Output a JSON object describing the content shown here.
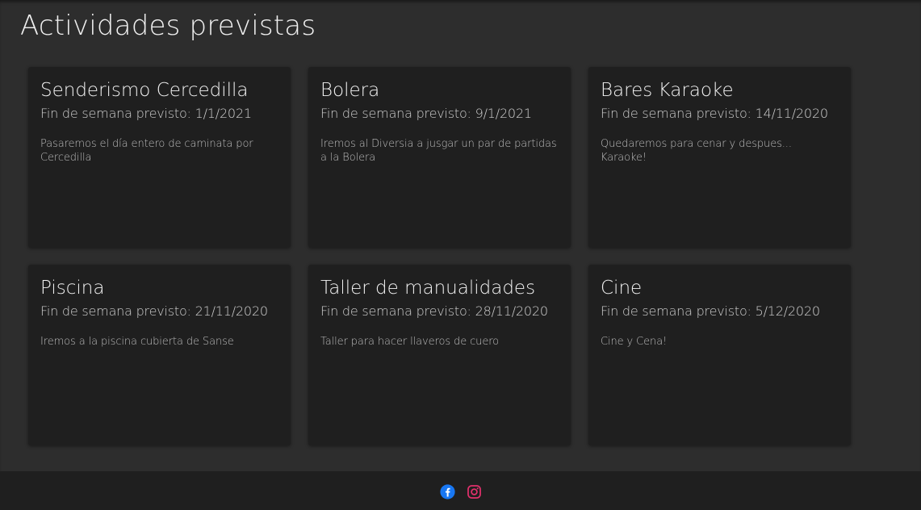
{
  "page": {
    "title": "Actividades previstas"
  },
  "activities": [
    {
      "title": "Senderismo Cercedilla",
      "date": "Fin de semana previsto: 1/1/2021",
      "description": "Pasaremos el día entero de caminata por Cercedilla"
    },
    {
      "title": "Bolera",
      "date": "Fin de semana previsto: 9/1/2021",
      "description": "Iremos al Diversia a jusgar un par de partidas a la Bolera"
    },
    {
      "title": "Bares Karaoke",
      "date": "Fin de semana previsto: 14/11/2020",
      "description": "Quedaremos para cenar y despues... Karaoke!"
    },
    {
      "title": "Piscina",
      "date": "Fin de semana previsto: 21/11/2020",
      "description": "Iremos a la piscina cubierta de Sanse"
    },
    {
      "title": "Taller de manualidades",
      "date": "Fin de semana previsto: 28/11/2020",
      "description": "Taller para hacer llaveros de cuero"
    },
    {
      "title": "Cine",
      "date": "Fin de semana previsto: 5/12/2020",
      "description": "Cine y Cena!"
    }
  ],
  "footer": {
    "social": [
      {
        "icon": "facebook-icon",
        "color": "#1877f2"
      },
      {
        "icon": "instagram-icon",
        "color": "#e1306c"
      }
    ]
  },
  "colors": {
    "background": "#2d2d2d",
    "card": "#1f1f1f",
    "footer": "#1f1f1f"
  }
}
